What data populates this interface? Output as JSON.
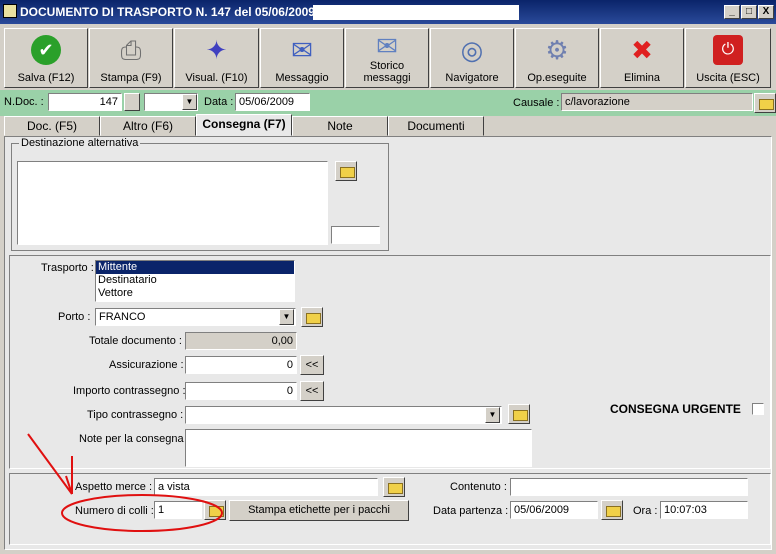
{
  "window": {
    "title": "DOCUMENTO DI TRASPORTO N. 147  del 05/06/2009",
    "min": "_",
    "max": "□",
    "close": "X"
  },
  "toolbar": [
    {
      "label": "Salva (F12)",
      "icon": "check-icon",
      "color": "#2aa02a"
    },
    {
      "label": "Stampa (F9)",
      "icon": "printer-icon",
      "color": "#707070"
    },
    {
      "label": "Visual. (F10)",
      "icon": "magic-wand-icon",
      "color": "#4040c0"
    },
    {
      "label": "Messaggio",
      "icon": "envelope-pen-icon",
      "color": "#4060c0"
    },
    {
      "label": "Storico\nmessaggi",
      "icon": "envelope-search-icon",
      "color": "#6080c0"
    },
    {
      "label": "Navigatore",
      "icon": "compass-icon",
      "color": "#5070b0"
    },
    {
      "label": "Op.eseguite",
      "icon": "gears-icon",
      "color": "#7080b0"
    },
    {
      "label": "Elimina",
      "icon": "x-icon",
      "color": "#e02020"
    },
    {
      "label": "Uscita (ESC)",
      "icon": "power-icon",
      "color": "#d02020"
    }
  ],
  "header": {
    "ndoc_label": "N.Doc. :",
    "ndoc_value": "147",
    "data_label": "Data :",
    "data_value": "05/06/2009",
    "causale_label": "Causale :",
    "causale_value": "c/lavorazione"
  },
  "tabs": [
    "Doc. (F5)",
    "Altro (F6)",
    "Consegna (F7)",
    "Note",
    "Documenti"
  ],
  "active_tab": "Consegna (F7)",
  "destinazione": {
    "legend": "Destinazione alternativa",
    "text": "",
    "code": ""
  },
  "trasporto": {
    "label": "Trasporto :",
    "options": [
      "Mittente",
      "Destinatario",
      "Vettore"
    ],
    "selected": "Mittente"
  },
  "porto": {
    "label": "Porto :",
    "value": "FRANCO"
  },
  "totale": {
    "label": "Totale documento :",
    "value": "0,00"
  },
  "assicurazione": {
    "label": "Assicurazione :",
    "value": "0",
    "btn": "<<"
  },
  "importo": {
    "label": "Importo contrassegno :",
    "value": "0",
    "btn": "<<"
  },
  "tipo": {
    "label": "Tipo contrassegno :",
    "value": ""
  },
  "note": {
    "label": "Note per la consegna",
    "value": ""
  },
  "urgente": {
    "label": "CONSEGNA URGENTE",
    "checked": false
  },
  "bottom": {
    "aspetto_label": "Aspetto merce :",
    "aspetto_value": "a vista",
    "colli_label": "Numero di colli :",
    "colli_value": "1",
    "stampa_btn": "Stampa etichette per i pacchi",
    "contenuto_label": "Contenuto :",
    "contenuto_value": "",
    "partenza_label": "Data partenza :",
    "partenza_value": "05/06/2009",
    "ora_label": "Ora :",
    "ora_value": "10:07:03"
  },
  "annotation_color": "#e01010"
}
